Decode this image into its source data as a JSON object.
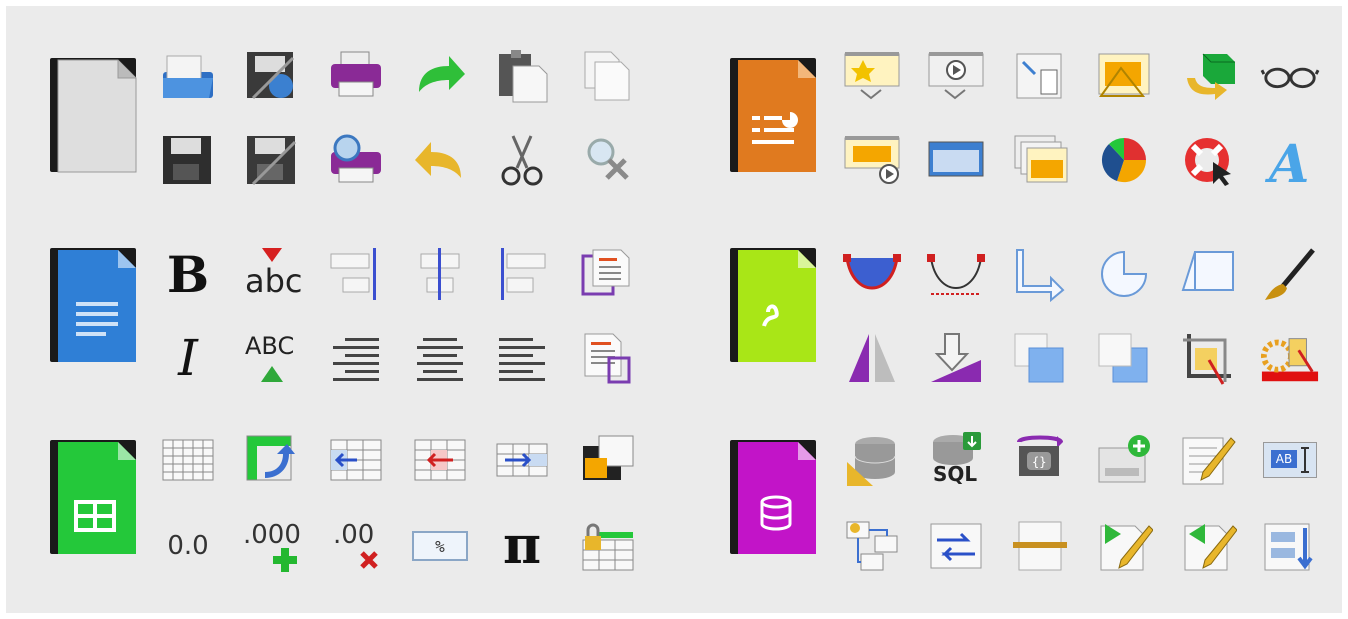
{
  "palette": {
    "background": "#ebebeb",
    "generic": "#d8d8d8",
    "writer": "#2f7fd6",
    "impress": "#e07a1f",
    "draw": "#a9e617",
    "calc": "#24c83a",
    "base": "#c214c8"
  },
  "groups": {
    "generic": {
      "app_icon": "libreoffice-document-icon",
      "icons": [
        "open-icon",
        "export-icon",
        "print-icon",
        "redo-icon",
        "paste-icon",
        "copy-icon",
        "save-icon",
        "save-as-icon",
        "print-preview-icon",
        "undo-icon",
        "cut-icon",
        "find-replace-icon"
      ]
    },
    "impress": {
      "app_icon": "libreoffice-impress-icon",
      "icons": [
        "new-slide-icon",
        "start-presentation-icon",
        "insert-object-icon",
        "slide-design-icon",
        "3d-object-icon",
        "glasses-icon",
        "presentation-from-current-icon",
        "slide-layout-icon",
        "slides-icon",
        "pie-chart-icon",
        "help-lifebuoy-icon",
        "fontwork-icon"
      ]
    },
    "writer": {
      "app_icon": "libreoffice-writer-icon",
      "text": {
        "bold": "B",
        "spell": "abc",
        "italic": "I",
        "autocorrect": "ABC"
      },
      "icons": [
        "bold-icon",
        "spellcheck-icon",
        "align-right-objects-icon",
        "align-center-objects-icon",
        "align-left-objects-icon",
        "page-columns-icon",
        "italic-icon",
        "autocorrect-icon",
        "align-text-right-icon",
        "align-text-center-icon",
        "align-text-left-icon",
        "text-frame-link-icon"
      ]
    },
    "draw": {
      "app_icon": "libreoffice-draw-icon",
      "icons": [
        "bezier-fill-icon",
        "bezier-curve-icon",
        "connector-arrow-icon",
        "circle-pie-icon",
        "parallelogram-icon",
        "paintbrush-icon",
        "flip-icon",
        "extrusion-icon",
        "bring-forward-icon",
        "send-backward-icon",
        "crop-icon",
        "gradient-icon"
      ]
    },
    "calc": {
      "app_icon": "libreoffice-calc-icon",
      "text": {
        "number_format": "0.0",
        "add_decimal": ".000",
        "remove_decimal": ".00",
        "percent": "%",
        "pi": "π"
      },
      "icons": [
        "spreadsheet-grid-icon",
        "transpose-icon",
        "insert-cells-left-icon",
        "delete-cells-icon",
        "insert-cells-right-icon",
        "freeze-panes-icon",
        "number-format-icon",
        "add-decimal-icon",
        "delete-decimal-icon",
        "percent-format-icon",
        "pi-icon",
        "protect-sheet-icon"
      ]
    },
    "base": {
      "app_icon": "libreoffice-base-icon",
      "text": {
        "sql": "SQL",
        "ab": "AB"
      },
      "icons": [
        "database-design-icon",
        "sql-query-icon",
        "macro-run-icon",
        "add-record-icon",
        "edit-form-icon",
        "text-field-icon",
        "relationships-icon",
        "data-exchange-icon",
        "page-break-icon",
        "next-record-icon",
        "previous-record-icon",
        "form-sort-icon"
      ]
    }
  }
}
